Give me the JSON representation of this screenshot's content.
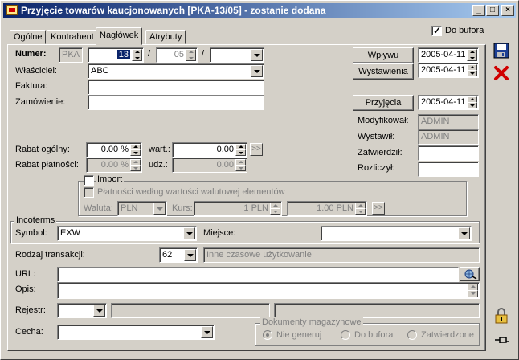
{
  "window": {
    "title": "Przyjęcie towarów kaucjonowanych [PKA-13/05]  - zostanie dodana",
    "controls": {
      "minimize": "_",
      "maximize": "□",
      "close": "×"
    }
  },
  "tabs": [
    "Ogólne",
    "Kontrahent",
    "Nagłówek",
    "Atrybuty"
  ],
  "active_tab": "Nagłówek",
  "do_bufora": {
    "label": "Do bufora",
    "checked": true
  },
  "numer": {
    "label": "Numer:",
    "prefix": "PKA",
    "number": "13",
    "sep1": "/",
    "year": "05",
    "sep2": "/",
    "series": ""
  },
  "wlasciciel": {
    "label": "Właściciel:",
    "value": "ABC"
  },
  "faktura": {
    "label": "Faktura:",
    "value": ""
  },
  "zamowienie": {
    "label": "Zamówienie:",
    "value": ""
  },
  "dates": {
    "wplywu": {
      "label": "Wpływu",
      "value": "2005-04-11"
    },
    "wystawienia": {
      "label": "Wystawienia",
      "value": "2005-04-11"
    },
    "przyjecia": {
      "label": "Przyjęcia",
      "value": "2005-04-11"
    }
  },
  "users": {
    "modyfikowal": {
      "label": "Modyfikował:",
      "value": "ADMIN"
    },
    "wystawil": {
      "label": "Wystawił:",
      "value": "ADMIN"
    },
    "zatwierdzil": {
      "label": "Zatwierdził:",
      "value": ""
    },
    "rozliczyl": {
      "label": "Rozliczył:",
      "value": ""
    }
  },
  "rabat": {
    "ogolny_label": "Rabat ogólny:",
    "ogolny_value": "0.00 %",
    "wart_label": "wart.:",
    "wart_value": "0.00",
    "platnosci_label": "Rabat płatności:",
    "platnosci_value": "0.00 %",
    "udz_label": "udz.:",
    "udz_value": "0.00",
    "arrow": ">>"
  },
  "import": {
    "label": "Import",
    "checked": false,
    "platnosci_label": "Płatności według wartości walutowej elementów",
    "waluta_label": "Waluta:",
    "waluta_value": "PLN",
    "kurs_label": "Kurs:",
    "kurs_value1": "1 PLN",
    "kurs_value2": "1.00 PLN",
    "arrow": ">>"
  },
  "incoterms": {
    "title": "Incoterms",
    "symbol_label": "Symbol:",
    "symbol_value": "EXW",
    "miejsce_label": "Miejsce:",
    "miejsce_value": ""
  },
  "rodzaj": {
    "label": "Rodzaj transakcji:",
    "code": "62",
    "description": "Inne czasowe użytkowanie"
  },
  "url": {
    "label": "URL:",
    "value": ""
  },
  "opis": {
    "label": "Opis:",
    "value": ""
  },
  "rejestr": {
    "label": "Rejestr:",
    "value": ""
  },
  "cecha": {
    "label": "Cecha:",
    "value": ""
  },
  "dokumenty": {
    "title": "Dokumenty magazynowe",
    "options": [
      "Nie generuj",
      "Do bufora",
      "Zatwierdzone"
    ],
    "selected": "Nie generuj"
  },
  "colors": {
    "title_start": "#0a246a",
    "title_end": "#a6caf0",
    "face": "#d4d0c8",
    "delete_red": "#d00000",
    "save_blue": "#1c3f95"
  }
}
